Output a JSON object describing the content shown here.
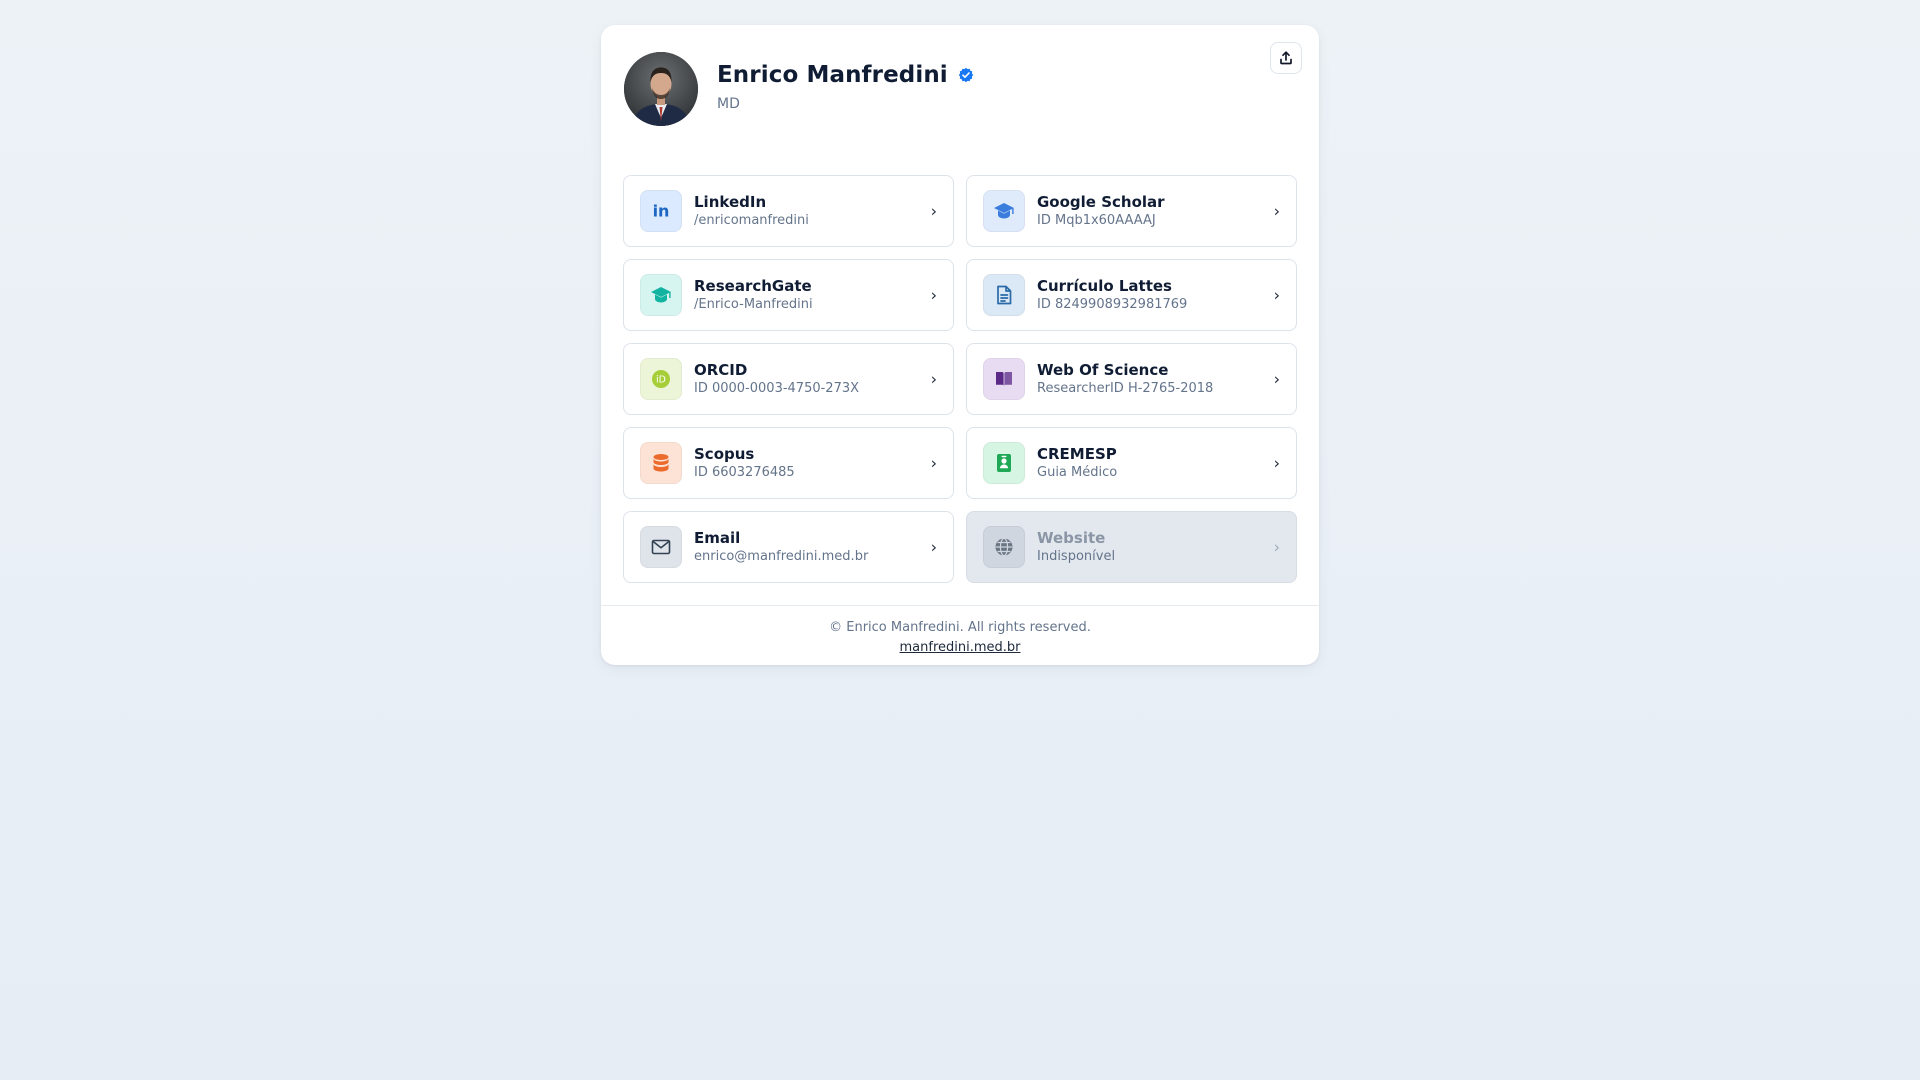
{
  "profile": {
    "name": "Enrico Manfredini",
    "credential": "MD",
    "verified_icon": "verified-check-icon",
    "share_icon": "share-upload-icon"
  },
  "links": [
    {
      "id": "linkedin",
      "title": "LinkedIn",
      "subtitle": "/enricomanfredini",
      "icon": "linkedin-icon",
      "bg": "#dbeafe",
      "fg": "#1d67c2",
      "enabled": true
    },
    {
      "id": "google-scholar",
      "title": "Google Scholar",
      "subtitle": "ID Mqb1x60AAAAJ",
      "icon": "graduation-cap-icon",
      "bg": "#dfeafb",
      "fg": "#3b7ddd",
      "enabled": true
    },
    {
      "id": "researchgate",
      "title": "ResearchGate",
      "subtitle": "/Enrico-Manfredini",
      "icon": "graduation-cap-icon",
      "bg": "#d6f5f0",
      "fg": "#12b3a0",
      "enabled": true
    },
    {
      "id": "curriculo-lattes",
      "title": "Currículo Lattes",
      "subtitle": "ID 8249908932981769",
      "icon": "document-icon",
      "bg": "#dbe8f5",
      "fg": "#2a6aa8",
      "enabled": true
    },
    {
      "id": "orcid",
      "title": "ORCID",
      "subtitle": "ID 0000-0003-4750-273X",
      "icon": "orcid-icon",
      "bg": "#ecf5d8",
      "fg": "#a6ce39",
      "enabled": true
    },
    {
      "id": "web-of-science",
      "title": "Web Of Science",
      "subtitle": "ResearcherID H-2765-2018",
      "icon": "book-open-icon",
      "bg": "#e8dcf2",
      "fg": "#5b2a86",
      "enabled": true
    },
    {
      "id": "scopus",
      "title": "Scopus",
      "subtitle": "ID 6603276485",
      "icon": "database-icon",
      "bg": "#fde3d6",
      "fg": "#ec6a2c",
      "enabled": true
    },
    {
      "id": "cremesp",
      "title": "CREMESP",
      "subtitle": "Guia Médico",
      "icon": "id-badge-icon",
      "bg": "#d7f5e3",
      "fg": "#1fa855",
      "enabled": true
    },
    {
      "id": "email",
      "title": "Email",
      "subtitle": "enrico@manfredini.med.br",
      "icon": "envelope-icon",
      "bg": "#dfe4ea",
      "fg": "#334155",
      "enabled": true
    },
    {
      "id": "website",
      "title": "Website",
      "subtitle": "Indisponível",
      "icon": "globe-icon",
      "bg": "#cfd6df",
      "fg": "#6b7684",
      "enabled": false
    }
  ],
  "chevron": "›",
  "footer": {
    "copyright": "© Enrico Manfredini. All rights reserved.",
    "site": "manfredini.med.br"
  }
}
